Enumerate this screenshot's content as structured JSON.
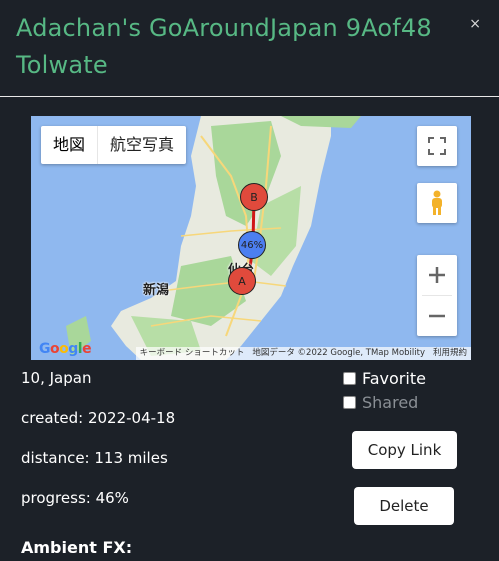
{
  "header": {
    "title": "Adachan's GoAroundJapan 9Aof48 Tolwate",
    "close_label": "×"
  },
  "map": {
    "type_buttons": [
      {
        "label": "地図",
        "selected": true
      },
      {
        "label": "航空写真",
        "selected": false
      }
    ],
    "markers": {
      "start": "A",
      "end": "B",
      "progress": "46%"
    },
    "city_labels": [
      "新潟",
      "仙台"
    ],
    "google_logo": "Google",
    "attribution": [
      "キーボード ショートカット",
      "地図データ ©2022 Google, TMap Mobility",
      "利用規約"
    ],
    "colors": {
      "water": "#8fb8ef",
      "land": "#e8eadf",
      "forest": "#a9d79a",
      "route": "#d01818"
    }
  },
  "details": {
    "location": "10, Japan",
    "created": "created: 2022-04-18",
    "distance": "distance: 113 miles",
    "progress": "progress: 46%"
  },
  "options": {
    "favorite_label": "Favorite",
    "shared_label": "Shared"
  },
  "actions": {
    "copy_link": "Copy Link",
    "delete": "Delete"
  },
  "ambient_label": "Ambient FX:",
  "progress_value": 0.46
}
